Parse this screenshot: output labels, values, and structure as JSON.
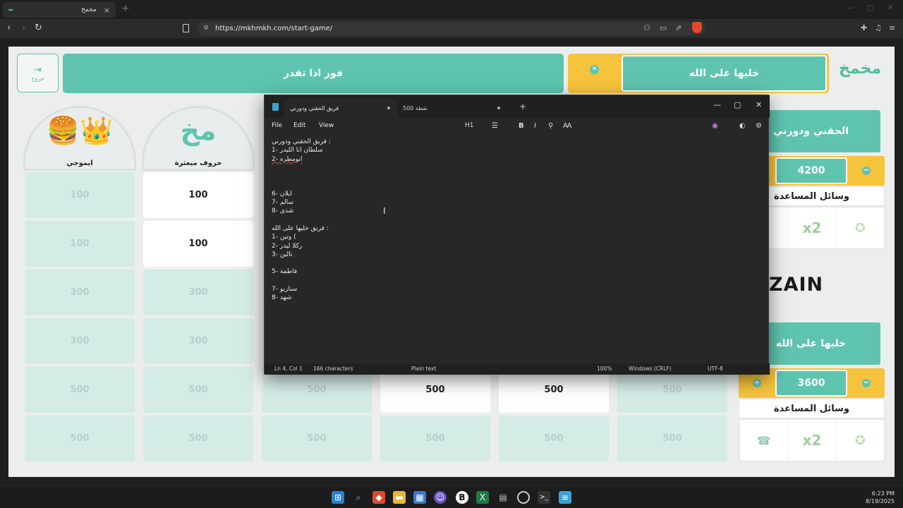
{
  "browser": {
    "tab_title": "مخمخ",
    "tab_close": "×",
    "new_tab": "+",
    "url": "https://mkhmkh.com/start-game/",
    "back": "‹",
    "forward": "›",
    "reload": "↻"
  },
  "game": {
    "exit_label": "خروج",
    "banner_text": "فوز اذا تقدر",
    "current_team": "خليها على الله",
    "logo_text": "مخمخ",
    "categories": [
      {
        "label": "ايموجي",
        "art": "🍔👑"
      },
      {
        "label": "حروف مبعثرة",
        "art": "مخ"
      }
    ],
    "cells": [
      [
        "100",
        "100"
      ],
      [
        "100",
        "100"
      ],
      [
        "300",
        "300"
      ],
      [
        "300",
        "300"
      ],
      [
        "500",
        "500",
        "500",
        "500",
        "500",
        "500"
      ],
      [
        "500",
        "500",
        "500",
        "500",
        "500",
        "500"
      ]
    ]
  },
  "teams": [
    {
      "name": "الحقني ودورني",
      "score": "4200",
      "aids_title": "وسائل المساعدة",
      "minus": "−",
      "plus": "+"
    },
    {
      "name": "خليها على الله",
      "score": "3600",
      "aids_title": "وسائل المساعدة",
      "minus": "−",
      "plus": "+"
    }
  ],
  "aids": {
    "x2": "x2",
    "timer_icon": "timer-icon",
    "call_icon": "call-friend-icon"
  },
  "sponsor": "ZAIN",
  "notepad": {
    "tab_active": "فريق الحقني ودورني",
    "tab_inactive": "500 نقطة",
    "new_tab": "+",
    "menu": {
      "file": "File",
      "edit": "Edit",
      "view": "View"
    },
    "toolbar": {
      "heading": "H1",
      "bold": "B",
      "italic": "I"
    },
    "lines": [
      "فريق الحقني ودورني :",
      "1- سلطان انا الليدر",
      "2- ابومطره",
      "",
      "",
      "",
      "6- ايلان",
      "7- سالم",
      "8- شذى",
      "",
      "فريق خليها على الله :",
      "1- وتين (",
      "2- ركلا ليدر",
      "3- تالين",
      "",
      "5- فاطمة",
      "",
      "7- سناريو",
      "8- شهد"
    ],
    "status": {
      "position": "Ln 4, Col 1",
      "chars": "166 characters",
      "format": "Plain text",
      "zoom": "100%",
      "eol": "Windows (CRLF)",
      "encoding": "UTF-8"
    }
  },
  "taskbar": {
    "time": "6:23 PM",
    "date": "8/19/2025"
  }
}
